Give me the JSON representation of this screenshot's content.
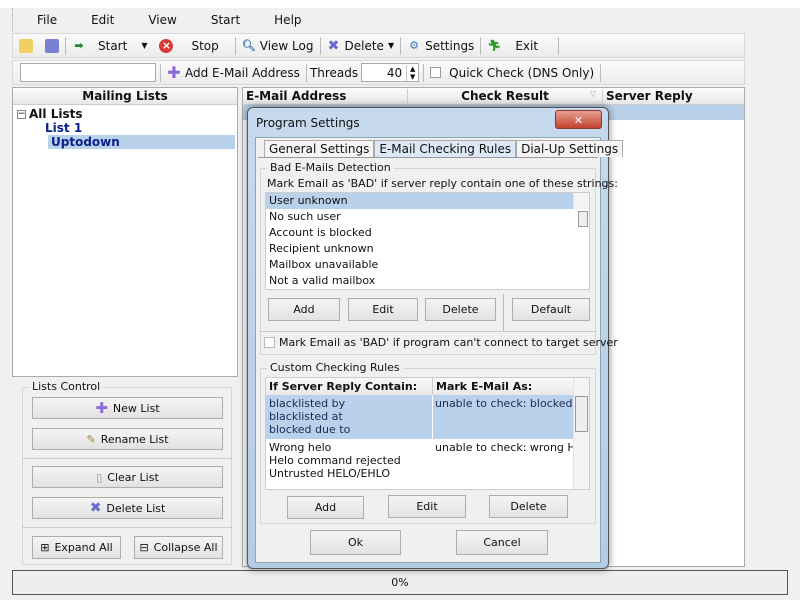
{
  "menu": [
    "File",
    "Edit",
    "View",
    "Start",
    "Help"
  ],
  "toolbar": {
    "start": "Start",
    "stop": "Stop",
    "view_log": "View Log",
    "delete": "Delete",
    "settings": "Settings",
    "exit": "Exit"
  },
  "toolbar2": {
    "search_value": "",
    "add_email": "Add E-Mail Address",
    "threads_label": "Threads",
    "threads_value": "40",
    "quick_check": "Quick Check (DNS Only)"
  },
  "left": {
    "header": "Mailing Lists",
    "tree": [
      "All Lists",
      "List 1",
      "Uptodown"
    ],
    "lists_control": {
      "title": "Lists Control",
      "new": "New List",
      "rename": "Rename List",
      "clear": "Clear List",
      "delete": "Delete List",
      "expand": "Expand All",
      "collapse": "Collapse All"
    }
  },
  "grid": {
    "columns": [
      "E-Mail Address",
      "Check Result",
      "Server Reply"
    ]
  },
  "status": {
    "progress": "0%"
  },
  "dialog": {
    "title": "Program Settings",
    "tabs": [
      "General Settings",
      "E-Mail Checking Rules",
      "Dial-Up Settings"
    ],
    "active_tab": 1,
    "bad": {
      "title": "Bad E-Mails Detection",
      "desc": "Mark Email as 'BAD' if server reply contain one of these strings:",
      "items": [
        "User unknown",
        "No such user",
        "Account is blocked",
        "Recipient unknown",
        "Mailbox unavailable",
        "Not a valid mailbox"
      ],
      "add": "Add",
      "edit": "Edit",
      "delete": "Delete",
      "default": "Default",
      "connect_check": "Mark Email as 'BAD' if program can't connect to target server"
    },
    "custom": {
      "title": "Custom Checking Rules",
      "columns": [
        "If Server Reply Contain:",
        "Mark E-Mail As:"
      ],
      "rows": [
        {
          "contains": [
            "blacklisted by",
            "blacklisted at",
            "blocked due to"
          ],
          "mark": "unable to check: blocked by"
        },
        {
          "contains": [
            "Wrong helo",
            "Helo command rejected",
            "Untrusted HELO/EHLO"
          ],
          "mark": "unable to check: wrong HEL"
        }
      ],
      "add": "Add",
      "edit": "Edit",
      "delete": "Delete"
    },
    "ok": "Ok",
    "cancel": "Cancel"
  }
}
